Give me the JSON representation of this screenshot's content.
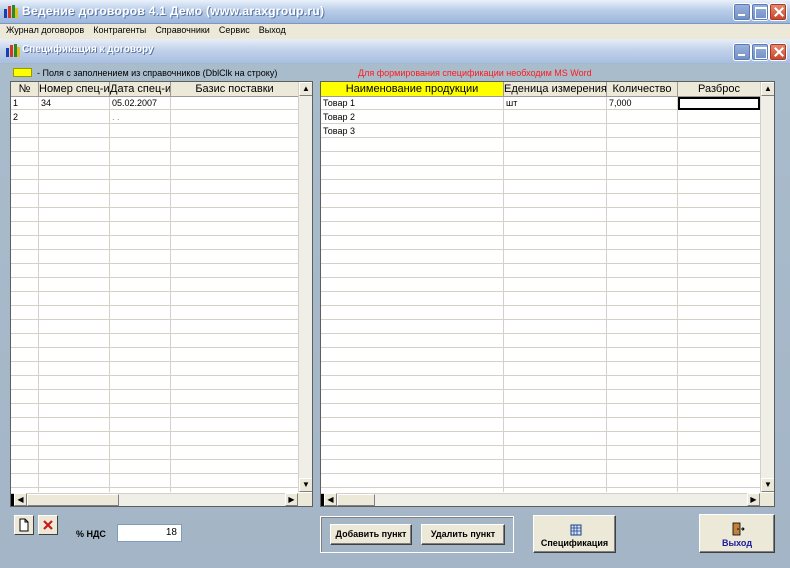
{
  "app": {
    "title": "Ведение договоров 4.1 Демо (www.araxgroup.ru)",
    "menu": [
      "Журнал договоров",
      "Контрагенты",
      "Справочники",
      "Сервис",
      "Выход"
    ]
  },
  "child_window": {
    "title": "Спецификация к договору"
  },
  "legend": {
    "yellow_text": "-  Поля с заполнением из справочников (DblClk на строку)",
    "warning_text": "Для формирования спецификации необходим MS Word",
    "yellow_color": "#ffff00",
    "warning_color": "#ff1a1a"
  },
  "left_grid": {
    "columns": [
      "№",
      "Номер спец-и",
      "Дата спец-и",
      "Базис поставки"
    ],
    "rows": [
      [
        "1",
        "34",
        "05.02.2007",
        ""
      ],
      [
        "2",
        "",
        ". .",
        ""
      ]
    ]
  },
  "right_grid": {
    "columns": [
      "Наименование продукции",
      "Еденица измерения",
      "Количество",
      "Разброс"
    ],
    "rows": [
      [
        "Товар 1",
        "шт",
        "7,000",
        ""
      ],
      [
        "Товар 2",
        "",
        "",
        ""
      ],
      [
        "Товар 3",
        "",
        "",
        ""
      ]
    ]
  },
  "bottom": {
    "vat_label": "% НДС",
    "vat_value": "18",
    "add_button": "Добавить пункт",
    "delete_button": "Удалить пункт",
    "spec_button": "Спецификация",
    "exit_button": "Выход"
  },
  "icons": [
    "app-icon",
    "minimize-icon",
    "maximize-icon",
    "close-icon",
    "new-record-icon",
    "delete-record-icon",
    "document-icon",
    "exit-door-icon"
  ]
}
